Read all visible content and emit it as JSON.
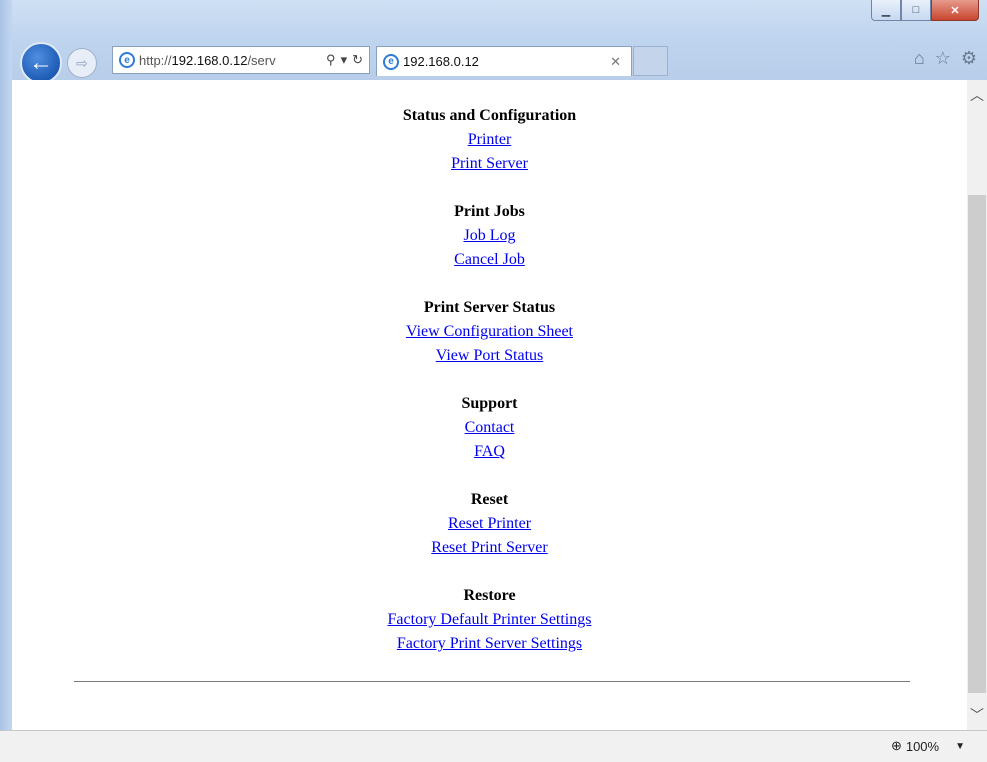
{
  "browser": {
    "address_url_prefix": "http://",
    "address_url_host": "192.168.0.12",
    "address_url_suffix": "/serv",
    "tab_title": "192.168.0.12",
    "zoom": "100%"
  },
  "page": {
    "sections": [
      {
        "heading": "Status and Configuration",
        "links": [
          "Printer",
          "Print Server"
        ]
      },
      {
        "heading": "Print Jobs",
        "links": [
          "Job Log",
          "Cancel Job"
        ]
      },
      {
        "heading": "Print Server Status",
        "links": [
          "View Configuration Sheet",
          "View Port Status"
        ]
      },
      {
        "heading": "Support",
        "links": [
          "Contact",
          "FAQ"
        ]
      },
      {
        "heading": "Reset",
        "links": [
          "Reset Printer",
          "Reset Print Server"
        ]
      },
      {
        "heading": "Restore",
        "links": [
          "Factory Default Printer Settings",
          "Factory Print Server Settings"
        ]
      }
    ]
  }
}
